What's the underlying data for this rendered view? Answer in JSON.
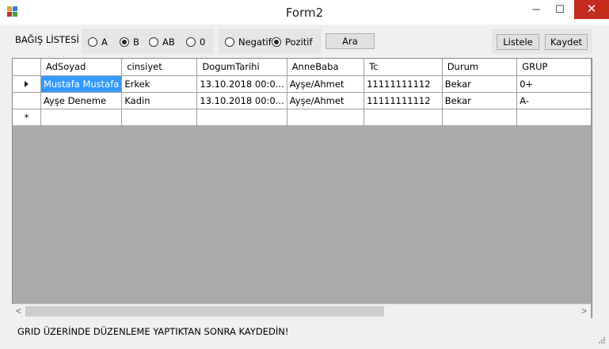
{
  "window": {
    "title": "Form2",
    "minimize": "─",
    "maximize": "☐",
    "close": "✕"
  },
  "toolbar": {
    "list_label": "BAĞIŞ LİSTESİ",
    "blood_groups": [
      {
        "label": "A",
        "checked": false
      },
      {
        "label": "B",
        "checked": true
      },
      {
        "label": "AB",
        "checked": false
      },
      {
        "label": "0",
        "checked": false
      }
    ],
    "rh": [
      {
        "label": "Negatif",
        "checked": false
      },
      {
        "label": "Pozitif",
        "checked": true
      }
    ],
    "search_label": "Ara",
    "list_button": "Listele",
    "save_button": "Kaydet"
  },
  "grid": {
    "columns": [
      "AdSoyad",
      "cinsiyet",
      "DogumTarihi",
      "AnneBaba",
      "Tc",
      "Durum",
      "GRUP"
    ],
    "rows": [
      [
        "Mustafa Mustafa",
        "Erkek",
        "13.10.2018 00:0...",
        "Ayşe/Ahmet",
        "11111111112",
        "Bekar",
        "0+"
      ],
      [
        "Ayşe Deneme",
        "Kadin",
        "13.10.2018 00:0...",
        "Ayşe/Ahmet",
        "11111111112",
        "Bekar",
        "A-"
      ]
    ],
    "new_row_marker": "*"
  },
  "scrollbar": {
    "left_arrow": "<",
    "right_arrow": ">"
  },
  "footer": {
    "message": "GRID ÜZERİNDE DÜZENLEME YAPTIKTAN SONRA KAYDEDİN!"
  }
}
